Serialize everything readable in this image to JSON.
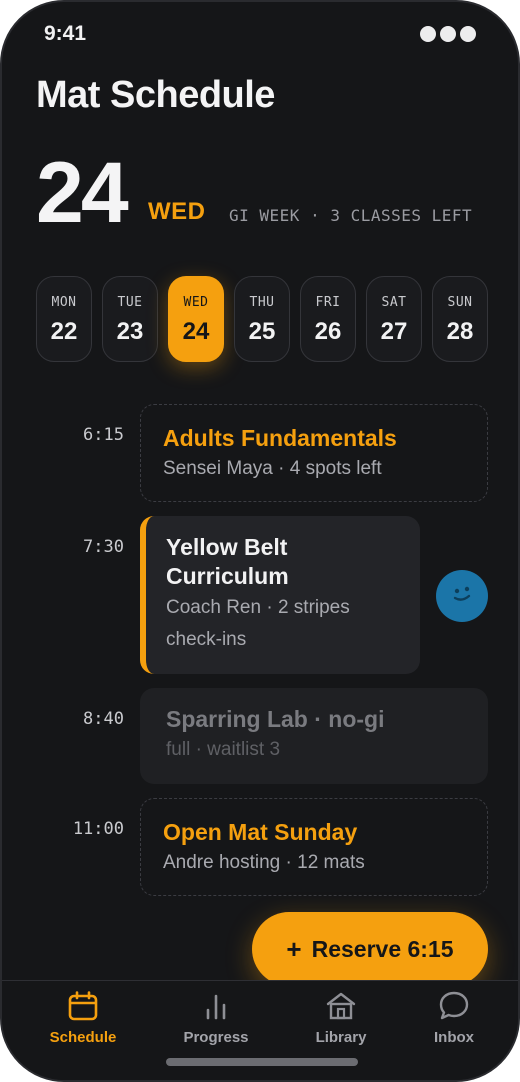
{
  "status": {
    "time": "9:41"
  },
  "header": {
    "title": "Mat Schedule"
  },
  "today": {
    "date": "24",
    "weekday": "WED",
    "note": "GI WEEK · 3 CLASSES LEFT"
  },
  "week": [
    {
      "name": "MON",
      "num": "22",
      "active": false
    },
    {
      "name": "TUE",
      "num": "23",
      "active": false
    },
    {
      "name": "WED",
      "num": "24",
      "active": true
    },
    {
      "name": "THU",
      "num": "25",
      "active": false
    },
    {
      "name": "FRI",
      "num": "26",
      "active": false
    },
    {
      "name": "SAT",
      "num": "27",
      "active": false
    },
    {
      "name": "SUN",
      "num": "28",
      "active": false
    }
  ],
  "classes": [
    {
      "time": "6:15",
      "title": "Adults Fundamentals",
      "sub": "Sensei Maya · 4 spots left",
      "state": "open"
    },
    {
      "time": "7:30",
      "title_line1": "Yellow Belt",
      "title_line2": "Curriculum",
      "sub_line1": "Coach Ren · 2 stripes",
      "sub_line2": "check-ins",
      "state": "booked"
    },
    {
      "time": "8:40",
      "title": "Sparring Lab · no-gi",
      "sub": "full · waitlist 3",
      "state": "full"
    },
    {
      "time": "11:00",
      "title": "Open Mat Sunday",
      "sub": "Andre hosting · 12 mats",
      "state": "open"
    }
  ],
  "fab": {
    "plus": "+",
    "label": "Reserve 6:15"
  },
  "tabs": [
    {
      "label": "Schedule",
      "icon": "calendar-icon",
      "active": true
    },
    {
      "label": "Progress",
      "icon": "bar-chart-icon",
      "active": false
    },
    {
      "label": "Library",
      "icon": "library-icon",
      "active": false
    },
    {
      "label": "Inbox",
      "icon": "chat-bubble-icon",
      "active": false
    }
  ],
  "colors": {
    "accent": "#f5a00f",
    "background": "#151618",
    "card": "#232428",
    "avatar": "#1b75a8"
  }
}
